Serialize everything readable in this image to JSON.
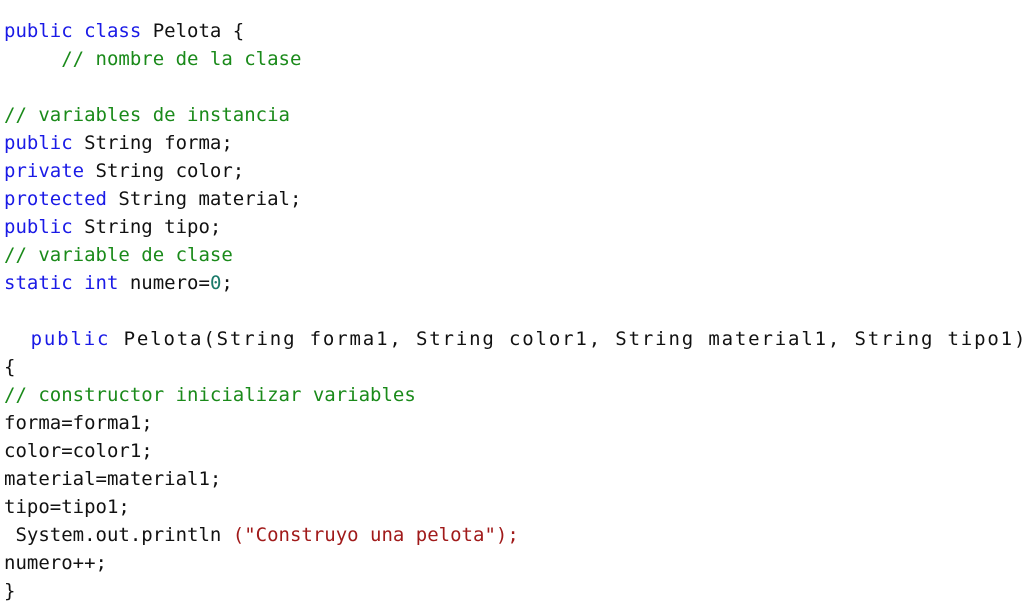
{
  "document": {
    "kind": "code-listing",
    "language": "Java",
    "background_color": "#ffffff"
  },
  "palette": {
    "keyword": "#1a1ae6",
    "comment": "#1a8a1a",
    "string": "#a01a1a",
    "number": "#1a7a6a",
    "plain": "#111111",
    "background": "#ffffff"
  },
  "code": {
    "lines": [
      {
        "index": 1,
        "wide": false,
        "text": "public class Pelota {",
        "tokens": [
          {
            "type": "keyword",
            "text": "public"
          },
          {
            "type": "plain",
            "text": " "
          },
          {
            "type": "keyword",
            "text": "class"
          },
          {
            "type": "plain",
            "text": " Pelota {"
          }
        ]
      },
      {
        "index": 2,
        "wide": false,
        "text": "     // nombre de la clase",
        "tokens": [
          {
            "type": "plain",
            "text": "     "
          },
          {
            "type": "comment",
            "text": "// nombre de la clase"
          }
        ]
      },
      {
        "index": 3,
        "wide": false,
        "text": "",
        "tokens": []
      },
      {
        "index": 4,
        "wide": false,
        "text": "// variables de instancia",
        "tokens": [
          {
            "type": "comment",
            "text": "// variables de instancia"
          }
        ]
      },
      {
        "index": 5,
        "wide": false,
        "text": "public String forma;",
        "tokens": [
          {
            "type": "keyword",
            "text": "public"
          },
          {
            "type": "plain",
            "text": " String forma;"
          }
        ]
      },
      {
        "index": 6,
        "wide": false,
        "text": "private String color;",
        "tokens": [
          {
            "type": "keyword",
            "text": "private"
          },
          {
            "type": "plain",
            "text": " String color;"
          }
        ]
      },
      {
        "index": 7,
        "wide": false,
        "text": "protected String material;",
        "tokens": [
          {
            "type": "keyword",
            "text": "protected"
          },
          {
            "type": "plain",
            "text": " String material;"
          }
        ]
      },
      {
        "index": 8,
        "wide": false,
        "text": "public String tipo;",
        "tokens": [
          {
            "type": "keyword",
            "text": "public"
          },
          {
            "type": "plain",
            "text": " String tipo;"
          }
        ]
      },
      {
        "index": 9,
        "wide": false,
        "text": "// variable de clase",
        "tokens": [
          {
            "type": "comment",
            "text": "// variable de clase"
          }
        ]
      },
      {
        "index": 10,
        "wide": false,
        "text": "static int numero=0;",
        "tokens": [
          {
            "type": "keyword",
            "text": "static"
          },
          {
            "type": "plain",
            "text": " "
          },
          {
            "type": "keyword",
            "text": "int"
          },
          {
            "type": "plain",
            "text": " numero="
          },
          {
            "type": "number",
            "text": "0"
          },
          {
            "type": "plain",
            "text": ";"
          }
        ]
      },
      {
        "index": 11,
        "wide": false,
        "text": "",
        "tokens": []
      },
      {
        "index": 12,
        "wide": true,
        "text": "  public Pelota(String forma1, String color1, String material1, String tipo1)",
        "tokens": [
          {
            "type": "plain",
            "text": "  "
          },
          {
            "type": "keyword",
            "text": "public"
          },
          {
            "type": "plain",
            "text": " Pelota(String forma1, String color1, String material1, String tipo1)"
          }
        ]
      },
      {
        "index": 13,
        "wide": false,
        "text": "{",
        "tokens": [
          {
            "type": "plain",
            "text": "{"
          }
        ]
      },
      {
        "index": 14,
        "wide": false,
        "text": "// constructor inicializar variables",
        "tokens": [
          {
            "type": "comment",
            "text": "// constructor inicializar variables"
          }
        ]
      },
      {
        "index": 15,
        "wide": false,
        "text": "forma=forma1;",
        "tokens": [
          {
            "type": "plain",
            "text": "forma=forma1;"
          }
        ]
      },
      {
        "index": 16,
        "wide": false,
        "text": "color=color1;",
        "tokens": [
          {
            "type": "plain",
            "text": "color=color1;"
          }
        ]
      },
      {
        "index": 17,
        "wide": false,
        "text": "material=material1;",
        "tokens": [
          {
            "type": "plain",
            "text": "material=material1;"
          }
        ]
      },
      {
        "index": 18,
        "wide": false,
        "text": "tipo=tipo1;",
        "tokens": [
          {
            "type": "plain",
            "text": "tipo=tipo1;"
          }
        ]
      },
      {
        "index": 19,
        "wide": false,
        "text": " System.out.println (\"Construyo una pelota\");",
        "tokens": [
          {
            "type": "plain",
            "text": " System.out.println "
          },
          {
            "type": "string",
            "text": "(\"Construyo una pelota\");"
          }
        ]
      },
      {
        "index": 20,
        "wide": false,
        "text": "numero++;",
        "tokens": [
          {
            "type": "plain",
            "text": "numero++;"
          }
        ]
      },
      {
        "index": 21,
        "wide": false,
        "text": "}",
        "tokens": [
          {
            "type": "plain",
            "text": "}"
          }
        ]
      }
    ]
  }
}
